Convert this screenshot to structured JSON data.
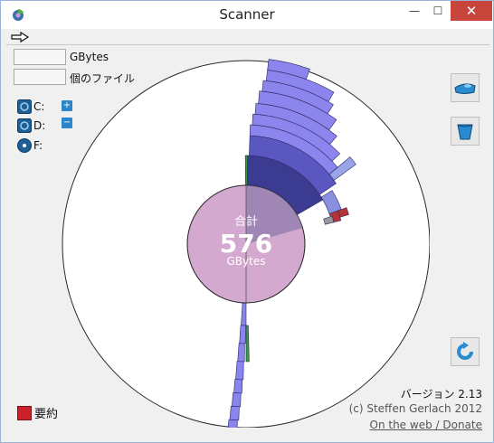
{
  "window": {
    "title": "Scanner"
  },
  "controls": {
    "minimize": "—",
    "maximize": "☐",
    "close": "✕"
  },
  "stats": {
    "size_unit": "GBytes",
    "files_label": "個のファイル"
  },
  "drives": [
    {
      "label": "C:",
      "icon": "drive-icon"
    },
    {
      "label": "D:",
      "icon": "drive-icon"
    },
    {
      "label": "F:",
      "icon": "optical-drive-icon"
    }
  ],
  "expanders": {
    "expand": "+",
    "collapse": "−"
  },
  "center": {
    "caption": "合計",
    "value": "576",
    "unit": "GBytes"
  },
  "summary": {
    "label": "要約"
  },
  "footer": {
    "version": "バージョン 2.13",
    "copyright": "(c) Steffen Gerlach 2012",
    "link": "On the web / Donate"
  },
  "colors": {
    "outer_ring": "#ffffff",
    "center_fill": "#d4a8d0",
    "segment_light": "#8c85ee",
    "segment_dark": "#3b3b92",
    "accent_red": "#b83434",
    "accent_green": "#3a9a3a"
  }
}
